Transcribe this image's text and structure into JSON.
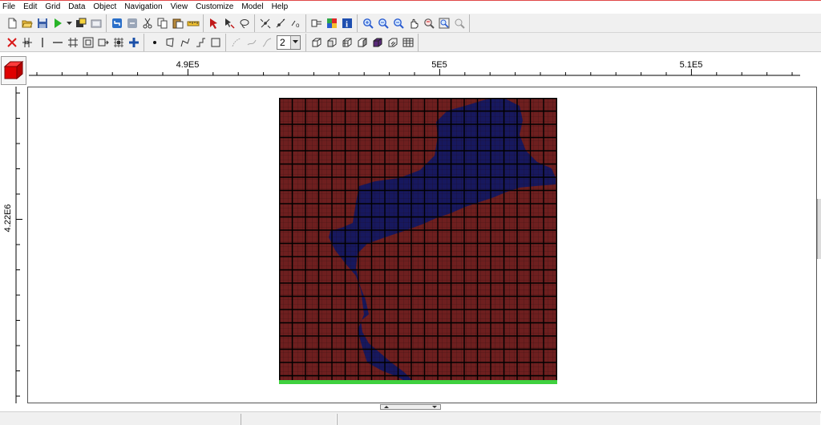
{
  "menu": {
    "items": [
      "File",
      "Edit",
      "Grid",
      "Data",
      "Object",
      "Navigation",
      "View",
      "Customize",
      "Model",
      "Help"
    ]
  },
  "toolbar": {
    "layer_value": "2"
  },
  "ruler": {
    "x_labels": [
      "4.9E5",
      "5E5",
      "5.1E5"
    ],
    "y_label": "4.22E6"
  },
  "colors": {
    "active_cell": "#6e1f1f",
    "inactive_region": "#17185e",
    "grid_line": "#000000",
    "boundary_row": "#3fd13f",
    "accent_red": "#e00000"
  },
  "icons": {
    "toolbar_row1": [
      "new-file-icon",
      "open-folder-icon",
      "save-icon",
      "run-icon",
      "run-dropdown-icon",
      "import-icon",
      "export-icon",
      "undo-icon",
      "redo-icon",
      "cut-icon",
      "copy-icon",
      "paste-icon",
      "ruler-icon",
      "select-arrow-icon",
      "select-node-icon",
      "lasso-icon",
      "node-select-icon",
      "edge-select-icon",
      "vertex-icon",
      "layers-icon",
      "color-map-icon",
      "info-icon",
      "zoom-in-icon",
      "zoom-window-icon",
      "zoom-out-icon",
      "pan-icon",
      "zoom-previous-icon",
      "zoom-extents-icon",
      "zoom-selection-icon"
    ],
    "toolbar_row2": [
      "delete-icon",
      "insert-column-icon",
      "vertical-line-icon",
      "horizontal-line-icon",
      "grid-icon",
      "refine-icon",
      "merge-icon",
      "grid-cell-icon",
      "add-cross-icon",
      "point-icon",
      "polygon-icon",
      "polyline-icon",
      "step-icon",
      "rectangle-icon",
      "arc-icon",
      "spline-icon",
      "curve-icon",
      "layer-combo-icon",
      "cube-view-icon",
      "cube-front-icon",
      "cube-side-icon",
      "cube-top-icon",
      "cube-solid-icon",
      "cube-wire-icon",
      "table-grid-icon"
    ]
  }
}
